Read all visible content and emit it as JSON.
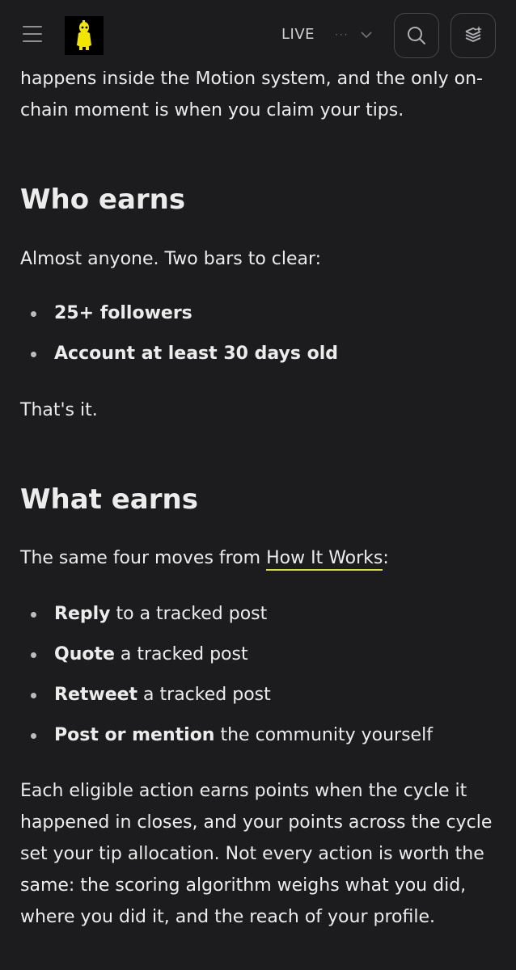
{
  "header": {
    "live_label": "LIVE",
    "dots": "···"
  },
  "intro": {
    "text": "happens inside the Motion system, and the only on-chain moment is when you claim your tips."
  },
  "who_earns": {
    "heading": "Who earns",
    "lead": "Almost anyone. Two bars to clear:",
    "items": [
      "25+ followers",
      "Account at least 30 days old"
    ],
    "outro": "That's it."
  },
  "what_earns": {
    "heading": "What earns",
    "lead_before": "The same four moves from ",
    "lead_link": "How It Works",
    "lead_after": ":",
    "items": [
      {
        "bold": "Reply",
        "rest": " to a tracked post"
      },
      {
        "bold": "Quote",
        "rest": " a tracked post"
      },
      {
        "bold": "Retweet",
        "rest": " a tracked post"
      },
      {
        "bold": "Post or mention",
        "rest": " the community yourself"
      }
    ],
    "body": "Each eligible action earns points when the cycle it happened in closes, and your points across the cycle set your tip allocation. Not every action is worth the same: the scoring algorithm weighs what you did, where you did it, and the reach of your profile."
  },
  "colors": {
    "background": "#1c1c1e",
    "link_underline": "#d4e04a",
    "logo_figure": "#f2e600"
  }
}
